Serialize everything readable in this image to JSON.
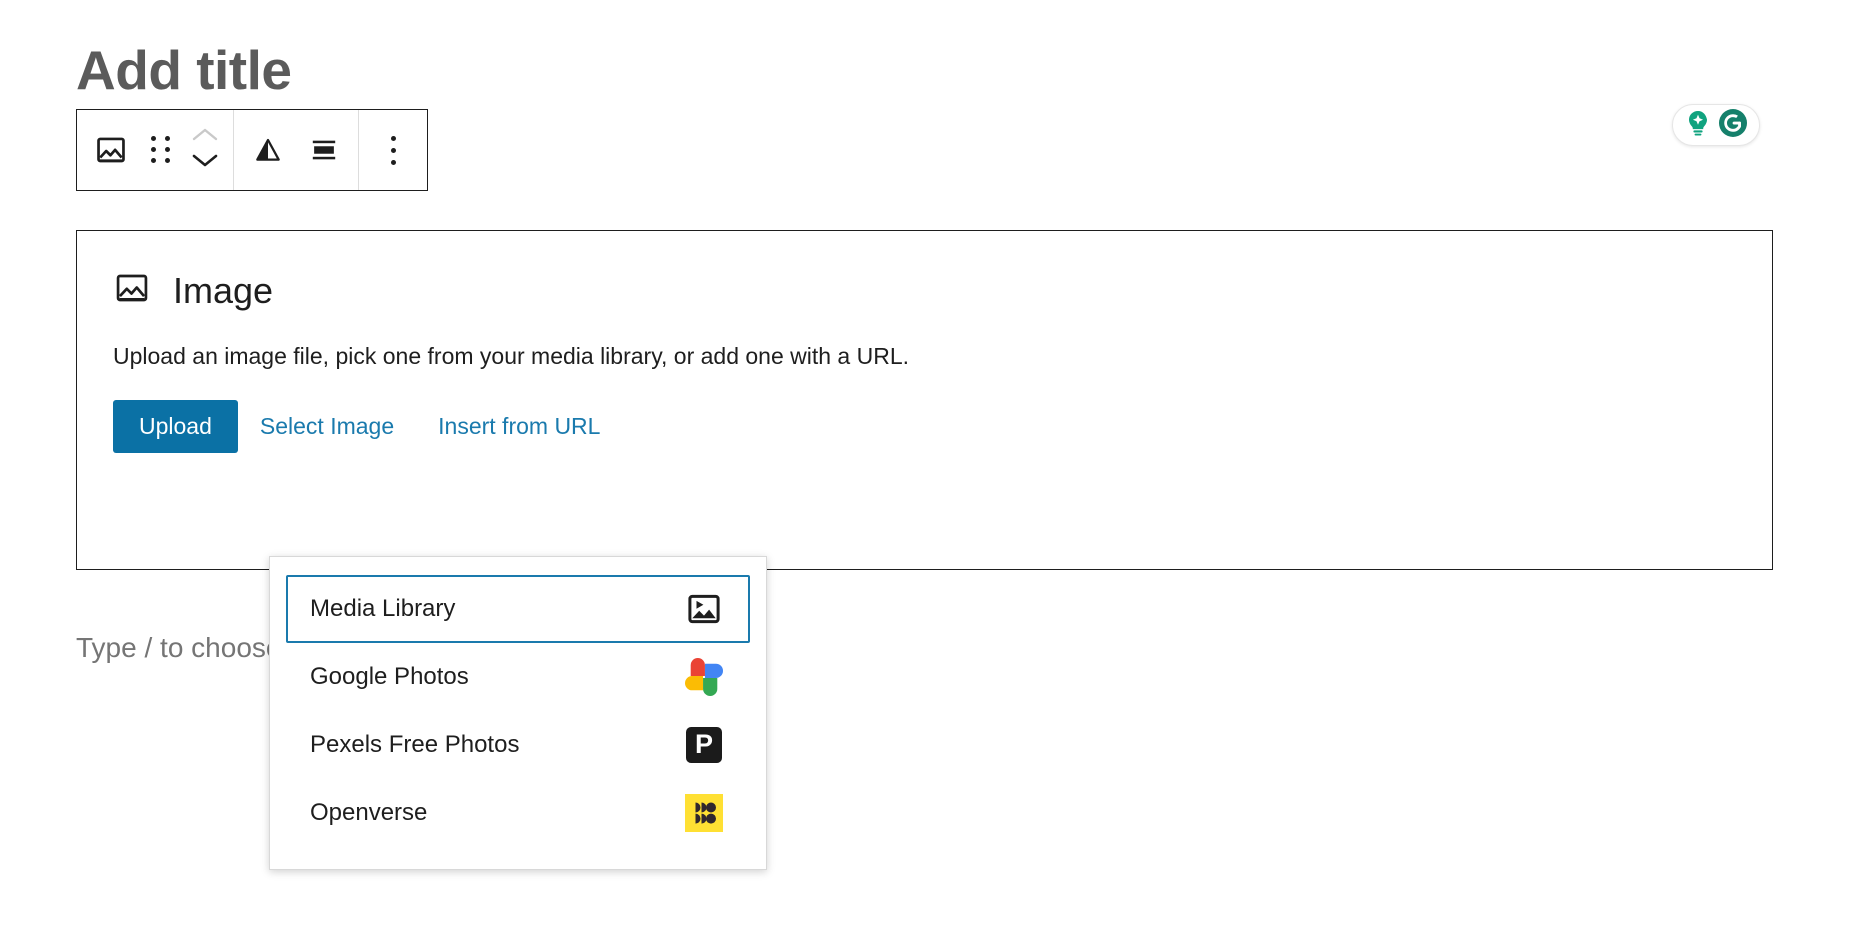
{
  "editor": {
    "post_title_placeholder": "Add title",
    "paragraph_placeholder": "Type / to choose a block"
  },
  "grammarly": {
    "assistant_icon": "lightbulb-sparkle-icon",
    "brand_icon": "grammarly-g-icon",
    "accent_color": "#10a37f",
    "brand_color": "#15806b"
  },
  "block_toolbar": {
    "buttons": [
      {
        "name": "block-type-image-icon",
        "label": "Image"
      },
      {
        "name": "drag-handle-icon",
        "label": "Drag"
      },
      {
        "name": "move-up-icon",
        "label": "Move up"
      },
      {
        "name": "move-down-icon",
        "label": "Move down"
      },
      {
        "name": "align-icon",
        "label": "Align"
      },
      {
        "name": "full-width-icon",
        "label": "Full width"
      },
      {
        "name": "more-options-icon",
        "label": "Options"
      }
    ]
  },
  "image_block": {
    "title": "Image",
    "icon": "image-icon",
    "description": "Upload an image file, pick one from your media library, or add one with a URL.",
    "upload_label": "Upload",
    "select_image_label": "Select Image",
    "insert_from_url_label": "Insert from URL",
    "upload_button_color": "#0b71a5",
    "link_color": "#1a7aad"
  },
  "media_menu": {
    "selected_index": 0,
    "highlight_color": "#1a7aad",
    "items": [
      {
        "label": "Media Library",
        "icon": "media-library-icon",
        "selected": true
      },
      {
        "label": "Google Photos",
        "icon": "google-photos-icon",
        "selected": false
      },
      {
        "label": "Pexels Free Photos",
        "icon": "pexels-icon",
        "selected": false
      },
      {
        "label": "Openverse",
        "icon": "openverse-icon",
        "selected": false
      }
    ]
  }
}
